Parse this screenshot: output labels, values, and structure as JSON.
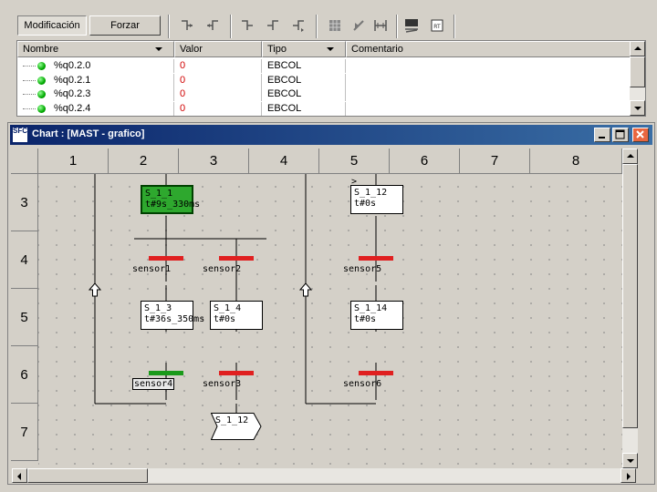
{
  "toolbar": {
    "modify_label": "Modificación",
    "force_label": "Forzar"
  },
  "var_table": {
    "headers": {
      "name": "Nombre",
      "value": "Valor",
      "type": "Tipo",
      "comment": "Comentario"
    },
    "rows": [
      {
        "name": "%q0.2.0",
        "value": "0",
        "type": "EBCOL",
        "comment": ""
      },
      {
        "name": "%q0.2.1",
        "value": "0",
        "type": "EBCOL",
        "comment": ""
      },
      {
        "name": "%q0.2.3",
        "value": "0",
        "type": "EBCOL",
        "comment": ""
      },
      {
        "name": "%q0.2.4",
        "value": "0",
        "type": "EBCOL",
        "comment": ""
      }
    ]
  },
  "chart_window": {
    "title": "Chart : [MAST - grafico]",
    "icon_text": "SFC",
    "columns": [
      "1",
      "2",
      "3",
      "4",
      "5",
      "6",
      "7",
      "8"
    ],
    "rows": [
      "3",
      "4",
      "5",
      "6",
      "7"
    ]
  },
  "sfc": {
    "steps": {
      "s1_1": {
        "name": "S_1_1",
        "time": "t#9s_330ms",
        "active": true
      },
      "s1_3": {
        "name": "S_1_3",
        "time": "t#36s_350ms",
        "active": false
      },
      "s1_4": {
        "name": "S_1_4",
        "time": "t#0s",
        "active": false
      },
      "s1_12": {
        "name": "S_1_12",
        "time": "t#0s",
        "active": false
      },
      "s1_14": {
        "name": "S_1_14",
        "time": "t#0s",
        "active": false
      }
    },
    "transitions": {
      "sensor1": "sensor1",
      "sensor2": "sensor2",
      "sensor5": "sensor5",
      "sensor4": "sensor4",
      "sensor3": "sensor3",
      "sensor6": "sensor6"
    },
    "jump_target": "S_1_12",
    "jump_marker": ">",
    "colors": {
      "active_step": "#2ea82e",
      "transition_false": "#e02020",
      "transition_true": "#1a9a1a"
    }
  }
}
